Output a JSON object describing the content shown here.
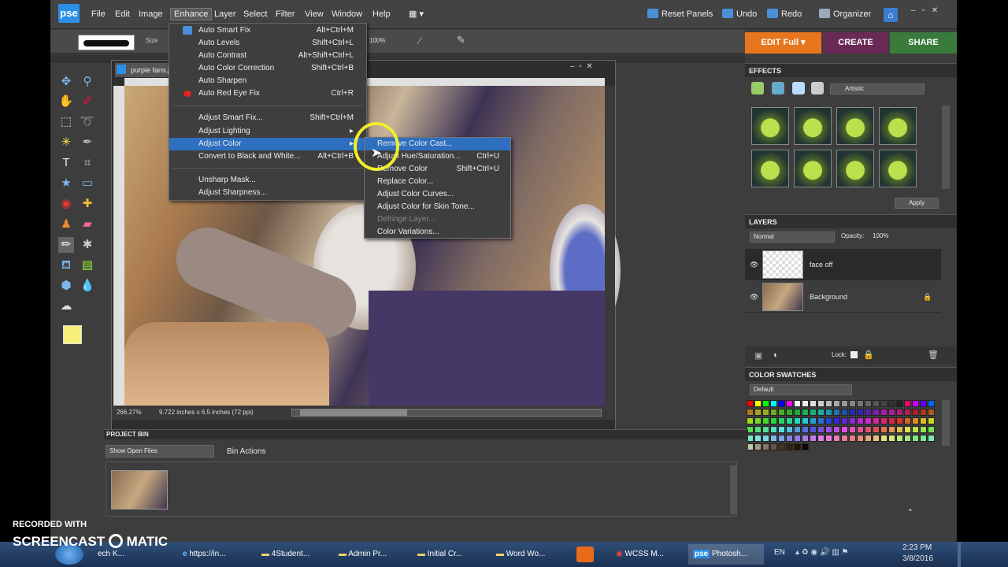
{
  "menubar": {
    "logo": "pse",
    "menus": [
      "File",
      "Edit",
      "Image",
      "Enhance",
      "Layer",
      "Select",
      "Filter",
      "View",
      "Window",
      "Help"
    ],
    "reset": "Reset Panels",
    "undo": "Undo",
    "redo": "Redo",
    "organizer": "Organizer"
  },
  "modes": {
    "edit": "EDIT Full",
    "create": "CREATE",
    "share": "SHARE"
  },
  "options": {
    "size_label": "Size",
    "opacity": "100%"
  },
  "document": {
    "tab": "purple fans.j",
    "zoom": "266.27%",
    "dimensions": "9.722 inches x 6.5 inches (72 ppi)"
  },
  "enhance_menu": [
    {
      "label": "Auto Smart Fix",
      "shortcut": "Alt+Ctrl+M"
    },
    {
      "label": "Auto Levels",
      "shortcut": "Shift+Ctrl+L"
    },
    {
      "label": "Auto Contrast",
      "shortcut": "Alt+Shift+Ctrl+L"
    },
    {
      "label": "Auto Color Correction",
      "shortcut": "Shift+Ctrl+B"
    },
    {
      "label": "Auto Sharpen",
      "shortcut": ""
    },
    {
      "label": "Auto Red Eye Fix",
      "shortcut": "Ctrl+R"
    },
    {
      "label": "Adjust Smart Fix...",
      "shortcut": "Shift+Ctrl+M"
    },
    {
      "label": "Adjust Lighting",
      "shortcut": ""
    },
    {
      "label": "Adjust Color",
      "shortcut": ""
    },
    {
      "label": "Convert to Black and White...",
      "shortcut": "Alt+Ctrl+B"
    },
    {
      "label": "Unsharp Mask...",
      "shortcut": ""
    },
    {
      "label": "Adjust Sharpness...",
      "shortcut": ""
    }
  ],
  "adjust_color_submenu": [
    {
      "label": "Remove Color Cast...",
      "shortcut": ""
    },
    {
      "label": "Adjust Hue/Saturation...",
      "shortcut": "Ctrl+U"
    },
    {
      "label": "Remove Color",
      "shortcut": "Shift+Ctrl+U"
    },
    {
      "label": "Replace Color...",
      "shortcut": ""
    },
    {
      "label": "Adjust Color Curves...",
      "shortcut": ""
    },
    {
      "label": "Adjust Color for Skin Tone...",
      "shortcut": ""
    },
    {
      "label": "Defringe Layer...",
      "shortcut": ""
    },
    {
      "label": "Color Variations...",
      "shortcut": ""
    }
  ],
  "project_bin": {
    "title": "PROJECT BIN",
    "show": "Show Open Files",
    "actions": "Bin Actions"
  },
  "effects": {
    "title": "EFFECTS",
    "category": "Artistic",
    "apply": "Apply"
  },
  "layers": {
    "title": "LAYERS",
    "blend": "Normal",
    "opacity_label": "Opacity:",
    "opacity": "100%",
    "lock": "Lock:",
    "items": [
      {
        "name": "face off"
      },
      {
        "name": "Background"
      }
    ]
  },
  "swatches": {
    "title": "COLOR SWATCHES",
    "set": "Default"
  },
  "taskbar": {
    "items": [
      "ech K...",
      "https://in...",
      "4Student...",
      "Admin Pr...",
      "Initial Cr...",
      "Word Wo...",
      "WCSS M...",
      "Photosh..."
    ],
    "lang": "EN",
    "time": "2:23 PM",
    "date": "3/8/2016"
  },
  "watermark": {
    "line1": "RECORDED WITH",
    "line2": "SCREENCAST",
    "line3": "MATIC"
  }
}
